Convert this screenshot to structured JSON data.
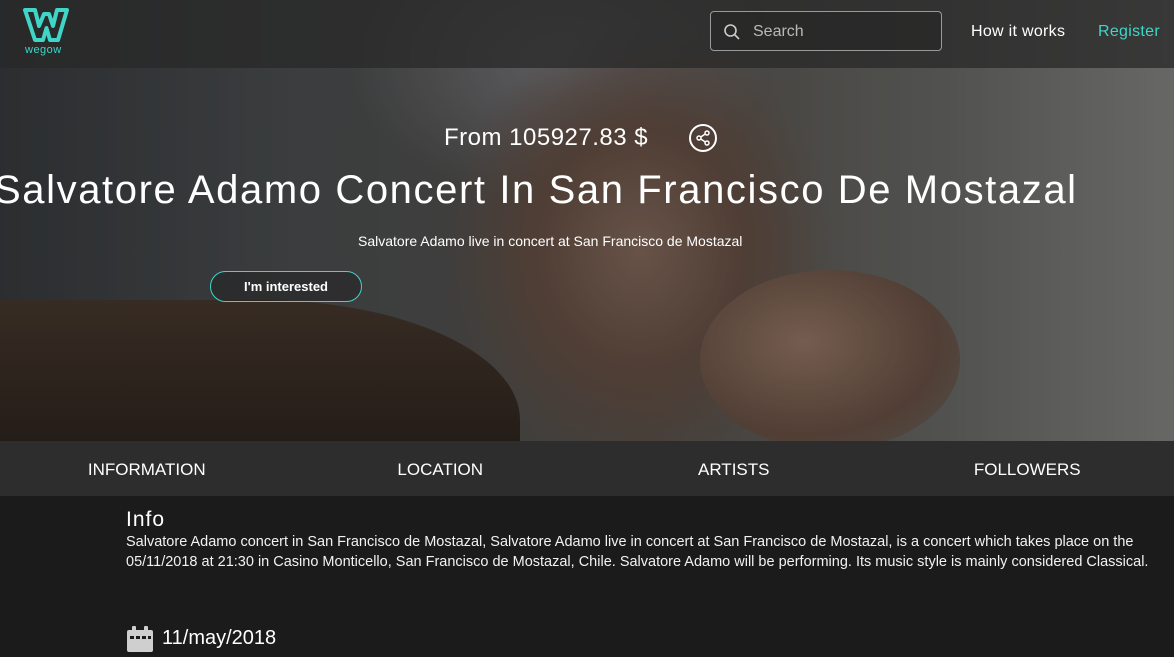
{
  "brand": {
    "name": "wegow",
    "accent": "#3fd6c8"
  },
  "nav": {
    "search_placeholder": "Search",
    "how_it_works": "How it works",
    "register": "Register"
  },
  "hero": {
    "price": "From 105927.83 $",
    "title": "Salvatore Adamo Concert In San Francisco De Mostazal",
    "subtitle": "Salvatore Adamo live in concert at San Francisco de Mostazal",
    "interested_button": "I'm interested"
  },
  "tabs": [
    {
      "label": "INFORMATION"
    },
    {
      "label": "LOCATION"
    },
    {
      "label": "ARTISTS"
    },
    {
      "label": "FOLLOWERS"
    }
  ],
  "info": {
    "heading": "Info",
    "text": "Salvatore Adamo concert in San Francisco de Mostazal, Salvatore Adamo live in concert at San Francisco de Mostazal, is a concert which takes place on the 05/11/2018 at 21:30 in Casino Monticello, San Francisco de Mostazal, Chile. Salvatore Adamo will be performing. Its music style is mainly considered Classical.",
    "date": "11/may/2018"
  }
}
